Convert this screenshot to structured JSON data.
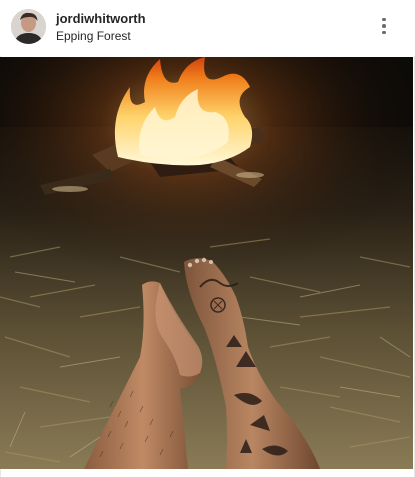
{
  "post": {
    "username": "jordiwhitworth",
    "location": "Epping Forest",
    "avatar_icon": "profile-avatar",
    "more_icon": "more-vertical-icon",
    "photo": {
      "subject": "bare legs with tattoos beside a campfire on straw",
      "colors": {
        "sky": "#0d0b08",
        "fire_core": "#fff4c2",
        "fire_outer": "#f08a1c",
        "straw": "#8d7a4f",
        "skin": "#b57e5a"
      }
    }
  }
}
